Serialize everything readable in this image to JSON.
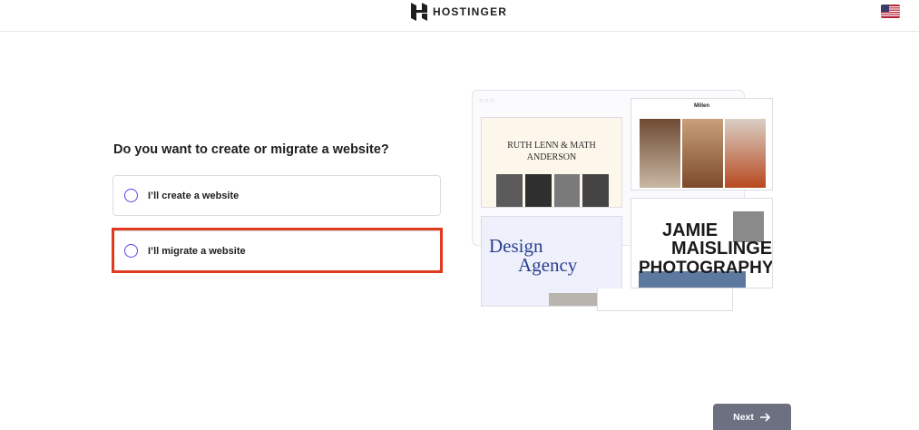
{
  "header": {
    "logo_text": "HOSTINGER",
    "logo_icon": "hostinger-logo-icon",
    "language_flag": "us-flag-icon"
  },
  "question": "Do you want to create or migrate a website?",
  "options": [
    {
      "label": "I’ll create a website",
      "selected": false
    },
    {
      "label": "I’ll migrate a website",
      "selected": false
    }
  ],
  "next_button": {
    "label": "Next",
    "icon": "arrow-right-icon"
  },
  "preview": {
    "card1_title_line1": "RUTH LENN & MATH",
    "card1_title_line2": "ANDERSON",
    "card2_name": "Millen",
    "card3_title_line1": "Design",
    "card3_title_line2": "Agency",
    "card4_line1": "JAMIE",
    "card4_line2": "MAISLINGER",
    "card4_line3": "PHOTOGRAPHY"
  },
  "colors": {
    "accent": "#673de6",
    "highlight": "#e03a1f",
    "next_button_bg": "#6d7081"
  }
}
